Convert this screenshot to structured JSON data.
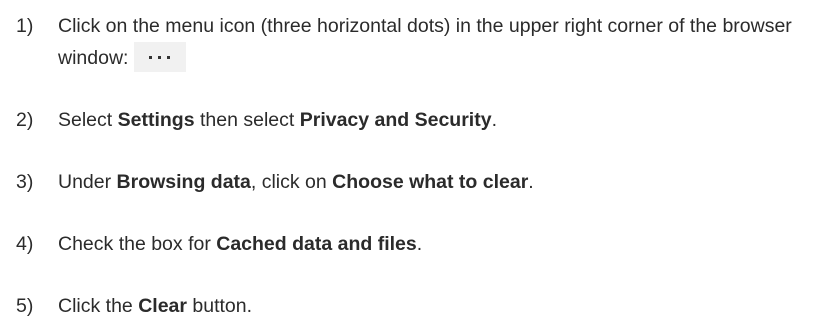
{
  "steps": [
    {
      "number": "1)",
      "text_a": "Click on the menu icon (three horizontal dots) in the upper right corner of the browser window:",
      "icon": "more-horizontal-icon"
    },
    {
      "number": "2)",
      "text_a": "Select ",
      "bold_a": "Settings",
      "text_b": " then select ",
      "bold_b": "Privacy and Security",
      "text_c": "."
    },
    {
      "number": "3)",
      "text_a": "Under ",
      "bold_a": "Browsing data",
      "text_b": ", click on ",
      "bold_b": "Choose what to clear",
      "text_c": "."
    },
    {
      "number": "4)",
      "text_a": "Check the box for ",
      "bold_a": "Cached data and files",
      "text_b": "."
    },
    {
      "number": "5)",
      "text_a": "Click the ",
      "bold_a": "Clear",
      "text_b": " button."
    }
  ]
}
